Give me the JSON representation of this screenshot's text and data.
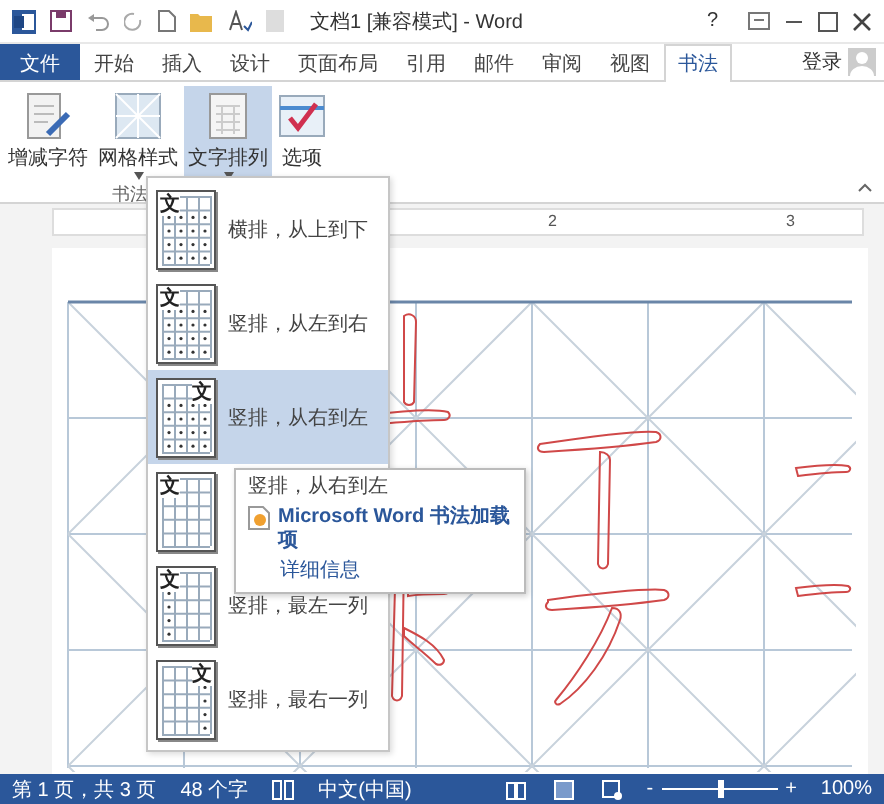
{
  "window": {
    "title": "文档1 [兼容模式] - Word",
    "help": "?"
  },
  "tabs": [
    {
      "label": "文件",
      "kind": "file",
      "selected": false
    },
    {
      "label": "开始",
      "kind": "tab",
      "selected": false
    },
    {
      "label": "插入",
      "kind": "tab",
      "selected": false
    },
    {
      "label": "设计",
      "kind": "tab",
      "selected": false
    },
    {
      "label": "页面布局",
      "kind": "tab",
      "selected": false
    },
    {
      "label": "引用",
      "kind": "tab",
      "selected": false
    },
    {
      "label": "邮件",
      "kind": "tab",
      "selected": false
    },
    {
      "label": "审阅",
      "kind": "tab",
      "selected": false
    },
    {
      "label": "视图",
      "kind": "tab",
      "selected": false
    },
    {
      "label": "书法",
      "kind": "tab",
      "selected": true
    }
  ],
  "account": {
    "label": "登录"
  },
  "ribbon": {
    "group_label": "书法",
    "buttons": [
      {
        "label": "增减字符",
        "kind": "chars",
        "dropdown": false,
        "selected": false
      },
      {
        "label": "网格样式",
        "kind": "grid",
        "dropdown": true,
        "selected": false
      },
      {
        "label": "文字排列",
        "kind": "arrange",
        "dropdown": true,
        "selected": true
      },
      {
        "label": "选项",
        "kind": "options",
        "dropdown": false,
        "selected": false
      }
    ]
  },
  "ruler": {
    "labels": [
      "2",
      "3"
    ]
  },
  "menu": {
    "items": [
      {
        "label": "横排，从上到下",
        "glyph": "文",
        "kind": "horizontal",
        "selected": false
      },
      {
        "label": "竖排，从左到右",
        "glyph": "文",
        "kind": "vertical-ltr",
        "selected": false
      },
      {
        "label": "竖排，从右到左",
        "glyph": "文",
        "kind": "vertical-rtl",
        "selected": true
      },
      {
        "glyph": "文",
        "kind": "plain",
        "selected": false
      },
      {
        "label": "竖排，最左一列",
        "glyph": "文",
        "kind": "first-column",
        "selected": false
      },
      {
        "label": "竖排，最右一列",
        "glyph": "文",
        "kind": "last-column",
        "selected": false
      }
    ]
  },
  "tooltip": {
    "title": "竖排，从右到左",
    "source": "Microsoft Word 书法加载项",
    "link": "详细信息"
  },
  "status_bar": {
    "page": "第 1 页，共 3 页",
    "words": "48 个字",
    "language": "中文(中国)",
    "zoom_out": "-",
    "zoom_in": "+",
    "zoom": "100%",
    "zoom_slider": {
      "level": 0.5
    }
  }
}
